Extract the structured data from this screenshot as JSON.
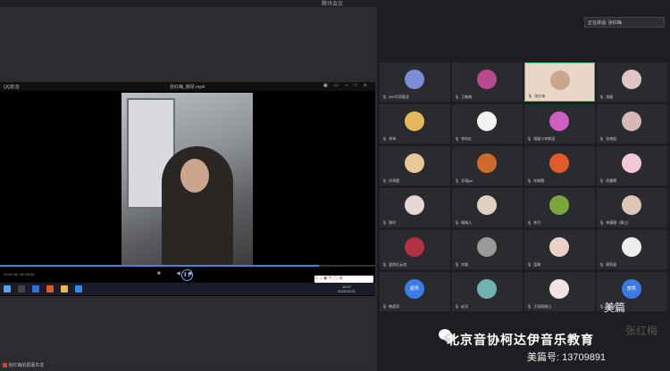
{
  "window": {
    "title": "腾讯会议"
  },
  "player": {
    "left_label": "QQ影音",
    "file_title": "张红梅_钢琴.mp4",
    "time": "00:02:36 / 00:08:36",
    "progress_fraction": 0.85
  },
  "taskbar": {
    "time": "16:07",
    "date": "2022/10/21"
  },
  "bottom_bar": {
    "label": "张红梅的屏幕共享"
  },
  "speaking": {
    "label": "正在讲话: 张红梅"
  },
  "participants": [
    {
      "name": "499号荷载凌",
      "avatar_color": "#7a8fd6"
    },
    {
      "name": "王敏楠",
      "avatar_color": "#b64a8f"
    },
    {
      "name": "张红梅",
      "avatar_color": "#caa68f",
      "active": true
    },
    {
      "name": "张媛",
      "avatar_color": "#e0c6c4"
    },
    {
      "name": "李琴",
      "avatar_color": "#e6b95c"
    },
    {
      "name": "李的红",
      "avatar_color": "#f2f2f2"
    },
    {
      "name": "相颖小李颜语",
      "avatar_color": "#cc5fc0"
    },
    {
      "name": "张艳丽",
      "avatar_color": "#d9b7b7"
    },
    {
      "name": "孙翠霞",
      "avatar_color": "#e7c99a"
    },
    {
      "name": "文珺jan",
      "avatar_color": "#d06a2c"
    },
    {
      "name": "宋晓晨",
      "avatar_color": "#e05a2a"
    },
    {
      "name": "徐晨曦",
      "avatar_color": "#f3c8d6"
    },
    {
      "name": "雅玲",
      "avatar_color": "#e6d6d6"
    },
    {
      "name": "晴晴儿",
      "avatar_color": "#e0d0c0"
    },
    {
      "name": "李丹",
      "avatar_color": "#7aa63c"
    },
    {
      "name": "李珊珊（黄山）",
      "avatar_color": "#dcc6b6"
    },
    {
      "name": "爱的红云浪",
      "avatar_color": "#b33040"
    },
    {
      "name": "刘颖",
      "avatar_color": "#999"
    },
    {
      "name": "蓝梅",
      "avatar_color": "#e8d2c4"
    },
    {
      "name": "周利丽",
      "avatar_color": "#eee"
    },
    {
      "name": "韩超男",
      "avatar_color": "#3b7be8",
      "avatar_text": "超男"
    },
    {
      "name": "赵洋",
      "avatar_color": "#6fb3b0"
    },
    {
      "name": "王丽丽旗山",
      "avatar_color": "#f1e3e3"
    },
    {
      "name": "张丽秀",
      "avatar_color": "#3b7be8",
      "avatar_text": "丽秀"
    }
  ],
  "overlay": {
    "meipian": "美篇",
    "brand": "北京音协柯达伊音乐教育",
    "phone": "美篇号: 13709891",
    "watermark": "张红梅"
  }
}
